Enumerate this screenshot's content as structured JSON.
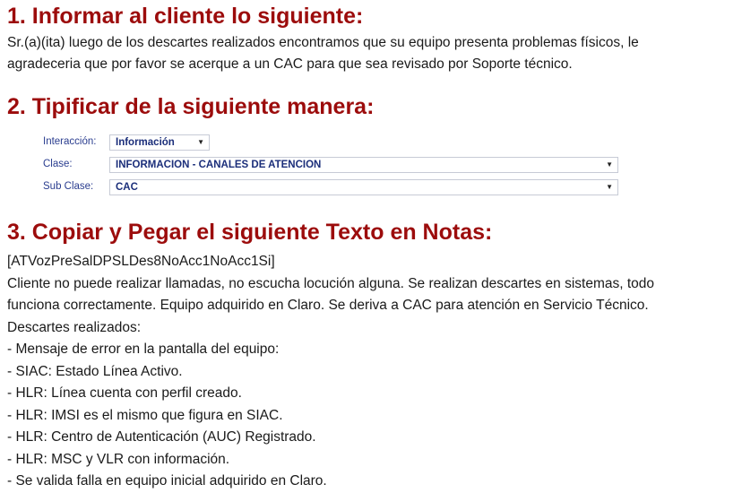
{
  "section1": {
    "heading": "1. Informar al cliente lo siguiente:",
    "text_line1": "Sr.(a)(ita) luego de los descartes realizados encontramos que su equipo presenta problemas físicos, le",
    "text_line2": "agradeceria que por favor se acerque a un CAC para que sea revisado por  Soporte técnico."
  },
  "section2": {
    "heading": "2. Tipificar de la siguiente manera:",
    "form": {
      "interaccion_label": "Interacción:",
      "interaccion_value": "Información",
      "clase_label": "Clase:",
      "clase_value": "INFORMACION - CANALES DE ATENCION",
      "subclase_label": "Sub Clase:",
      "subclase_value": "CAC"
    }
  },
  "section3": {
    "heading": "3. Copiar y Pegar el siguiente Texto en Notas:",
    "lines": [
      "[ATVozPreSalDPSLDes8NoAcc1NoAcc1Si]",
      "Cliente no puede realizar llamadas, no escucha locución alguna. Se realizan descartes en sistemas, todo",
      "funciona correctamente. Equipo adquirido en Claro. Se deriva a CAC para atención en Servicio Técnico.",
      "Descartes realizados:",
      "- Mensaje de error en la pantalla del equipo:",
      "- SIAC: Estado Línea Activo.",
      "- HLR: Línea cuenta con perfil creado.",
      "- HLR: IMSI es el mismo que figura en SIAC.",
      "- HLR: Centro de Autenticación (AUC) Registrado.",
      "- HLR: MSC y VLR con información.",
      "- Se valida falla en equipo inicial adquirido en Claro."
    ]
  }
}
